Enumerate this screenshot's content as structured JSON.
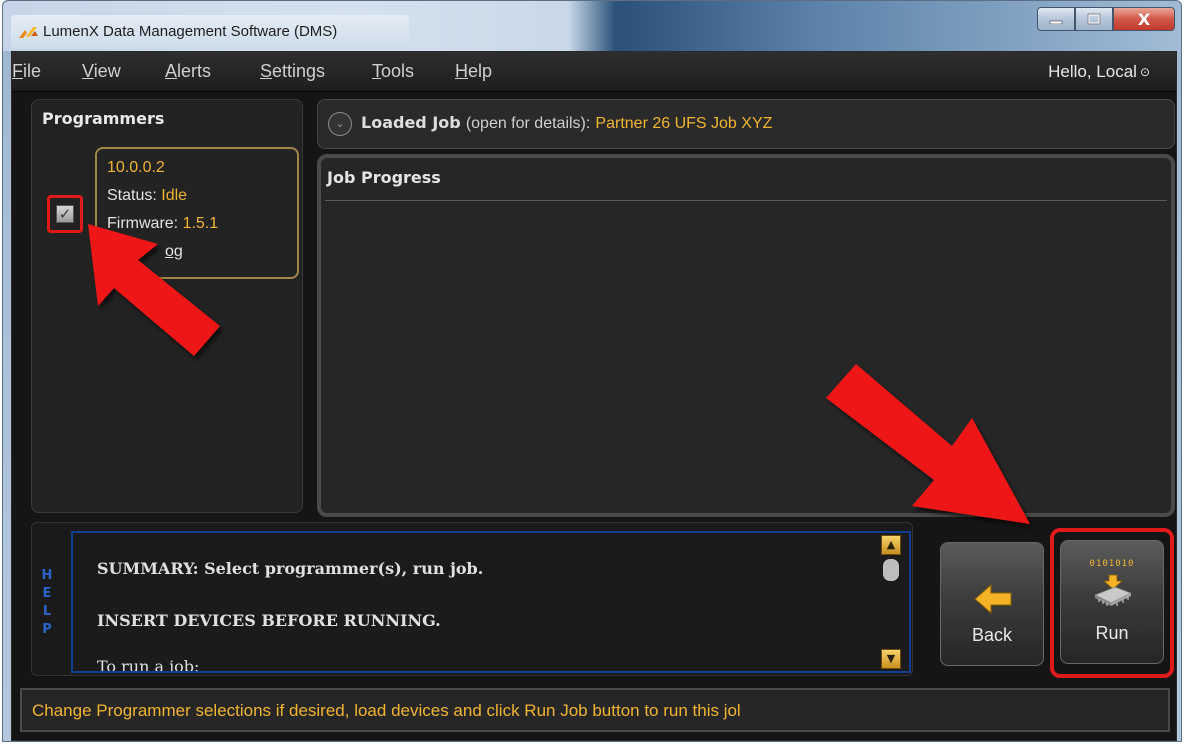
{
  "window": {
    "title": "LumenX Data Management Software (DMS)",
    "controls": {
      "minimize": "—",
      "maximize": "☐",
      "close": "X"
    }
  },
  "menu": {
    "items": [
      {
        "label_first": "F",
        "label_rest": "ile"
      },
      {
        "label_first": "V",
        "label_rest": "iew"
      },
      {
        "label_first": "A",
        "label_rest": "lerts"
      },
      {
        "label_first": "S",
        "label_rest": "ettings"
      },
      {
        "label_first": "T",
        "label_rest": "ools"
      },
      {
        "label_first": "H",
        "label_rest": "elp"
      }
    ],
    "greeting": "Hello, Local",
    "greeting_icon": "⊙"
  },
  "programmers": {
    "title": "Programmers",
    "checked": "✓",
    "card": {
      "address": "10.0.0.2",
      "status_label": "Status:",
      "status_value": "Idle",
      "firmware_label": "Firmware:",
      "firmware_value": "1.5.1",
      "link": "og"
    }
  },
  "loaded_job": {
    "expand_icon": "⌄",
    "label": "Loaded Job",
    "hint": "(open for details):",
    "name": "Partner 26 UFS Job XYZ"
  },
  "job_progress": {
    "title": "Job Progress"
  },
  "help": {
    "side_label": [
      "H",
      "E",
      "L",
      "P"
    ],
    "lines": [
      "SUMMARY: Select programmer(s), run job.",
      "INSERT DEVICES BEFORE RUNNING.",
      "To run a job:"
    ],
    "scroll_up": "▲",
    "scroll_down": "▼"
  },
  "buttons": {
    "back": "Back",
    "run": "Run",
    "run_binary": "0101010"
  },
  "status": {
    "message": "Change Programmer selections if desired, load devices and click Run Job button to run this jol"
  },
  "colors": {
    "accent_gold": "#f1b431",
    "annotation_red": "#e01a1a",
    "help_blue": "#123e91"
  }
}
